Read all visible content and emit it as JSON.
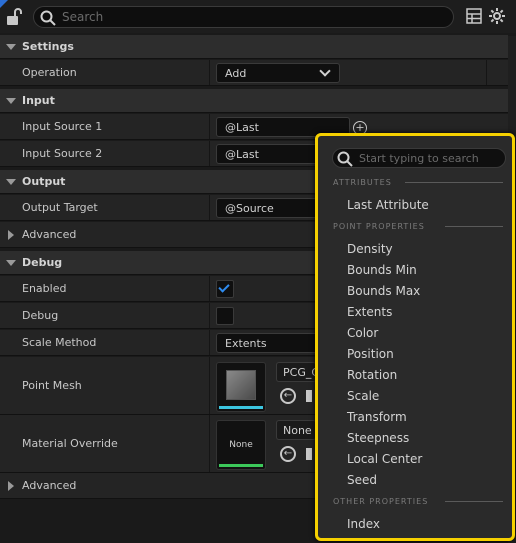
{
  "toolbar": {
    "search_placeholder": "Search"
  },
  "categories": {
    "settings": "Settings",
    "input": "Input",
    "output": "Output",
    "debug": "Debug"
  },
  "rows": {
    "operation": {
      "label": "Operation",
      "value": "Add"
    },
    "input_source_1": {
      "label": "Input Source 1",
      "value": "@Last"
    },
    "input_source_2": {
      "label": "Input Source 2",
      "value": "@Last"
    },
    "output_target": {
      "label": "Output Target",
      "value": "@Source"
    },
    "advanced_1": "Advanced",
    "enabled": {
      "label": "Enabled",
      "checked": true
    },
    "debug": {
      "label": "Debug",
      "checked": false
    },
    "scale_method": {
      "label": "Scale Method",
      "value": "Extents"
    },
    "point_mesh": {
      "label": "Point Mesh",
      "value": "PCG_C"
    },
    "material_override": {
      "label": "Material Override",
      "value": "None",
      "thumb": "None"
    },
    "advanced_2": "Advanced"
  },
  "popup": {
    "search_placeholder": "Start typing to search",
    "sections": {
      "attributes": "ATTRIBUTES",
      "point_properties": "POINT PROPERTIES",
      "other_properties": "OTHER PROPERTIES"
    },
    "attributes": [
      "Last Attribute"
    ],
    "point_properties": [
      "Density",
      "Bounds Min",
      "Bounds Max",
      "Extents",
      "Color",
      "Position",
      "Rotation",
      "Scale",
      "Transform",
      "Steepness",
      "Local Center",
      "Seed"
    ],
    "other_properties": [
      "Index"
    ]
  },
  "colors": {
    "highlight": "#f5d000",
    "checkbox": "#2f8cf0",
    "mesh_bar": "#3cc6e0",
    "material_bar": "#3cc85a"
  }
}
